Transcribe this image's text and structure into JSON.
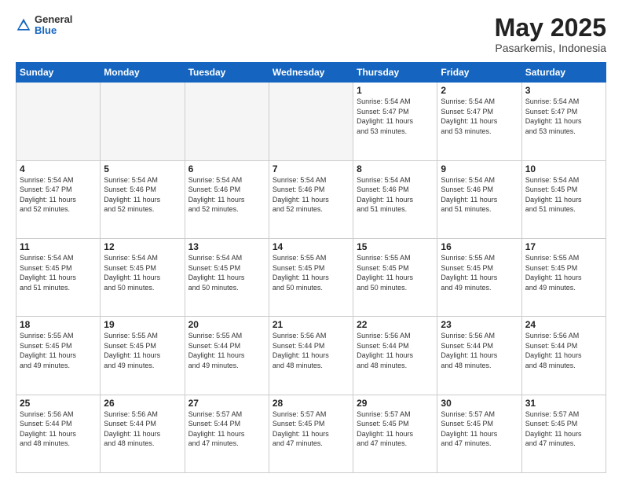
{
  "header": {
    "logo_general": "General",
    "logo_blue": "Blue",
    "month": "May 2025",
    "location": "Pasarkemis, Indonesia"
  },
  "days_of_week": [
    "Sunday",
    "Monday",
    "Tuesday",
    "Wednesday",
    "Thursday",
    "Friday",
    "Saturday"
  ],
  "weeks": [
    [
      {
        "day": "",
        "info": ""
      },
      {
        "day": "",
        "info": ""
      },
      {
        "day": "",
        "info": ""
      },
      {
        "day": "",
        "info": ""
      },
      {
        "day": "1",
        "info": "Sunrise: 5:54 AM\nSunset: 5:47 PM\nDaylight: 11 hours\nand 53 minutes."
      },
      {
        "day": "2",
        "info": "Sunrise: 5:54 AM\nSunset: 5:47 PM\nDaylight: 11 hours\nand 53 minutes."
      },
      {
        "day": "3",
        "info": "Sunrise: 5:54 AM\nSunset: 5:47 PM\nDaylight: 11 hours\nand 53 minutes."
      }
    ],
    [
      {
        "day": "4",
        "info": "Sunrise: 5:54 AM\nSunset: 5:47 PM\nDaylight: 11 hours\nand 52 minutes."
      },
      {
        "day": "5",
        "info": "Sunrise: 5:54 AM\nSunset: 5:46 PM\nDaylight: 11 hours\nand 52 minutes."
      },
      {
        "day": "6",
        "info": "Sunrise: 5:54 AM\nSunset: 5:46 PM\nDaylight: 11 hours\nand 52 minutes."
      },
      {
        "day": "7",
        "info": "Sunrise: 5:54 AM\nSunset: 5:46 PM\nDaylight: 11 hours\nand 52 minutes."
      },
      {
        "day": "8",
        "info": "Sunrise: 5:54 AM\nSunset: 5:46 PM\nDaylight: 11 hours\nand 51 minutes."
      },
      {
        "day": "9",
        "info": "Sunrise: 5:54 AM\nSunset: 5:46 PM\nDaylight: 11 hours\nand 51 minutes."
      },
      {
        "day": "10",
        "info": "Sunrise: 5:54 AM\nSunset: 5:45 PM\nDaylight: 11 hours\nand 51 minutes."
      }
    ],
    [
      {
        "day": "11",
        "info": "Sunrise: 5:54 AM\nSunset: 5:45 PM\nDaylight: 11 hours\nand 51 minutes."
      },
      {
        "day": "12",
        "info": "Sunrise: 5:54 AM\nSunset: 5:45 PM\nDaylight: 11 hours\nand 50 minutes."
      },
      {
        "day": "13",
        "info": "Sunrise: 5:54 AM\nSunset: 5:45 PM\nDaylight: 11 hours\nand 50 minutes."
      },
      {
        "day": "14",
        "info": "Sunrise: 5:55 AM\nSunset: 5:45 PM\nDaylight: 11 hours\nand 50 minutes."
      },
      {
        "day": "15",
        "info": "Sunrise: 5:55 AM\nSunset: 5:45 PM\nDaylight: 11 hours\nand 50 minutes."
      },
      {
        "day": "16",
        "info": "Sunrise: 5:55 AM\nSunset: 5:45 PM\nDaylight: 11 hours\nand 49 minutes."
      },
      {
        "day": "17",
        "info": "Sunrise: 5:55 AM\nSunset: 5:45 PM\nDaylight: 11 hours\nand 49 minutes."
      }
    ],
    [
      {
        "day": "18",
        "info": "Sunrise: 5:55 AM\nSunset: 5:45 PM\nDaylight: 11 hours\nand 49 minutes."
      },
      {
        "day": "19",
        "info": "Sunrise: 5:55 AM\nSunset: 5:45 PM\nDaylight: 11 hours\nand 49 minutes."
      },
      {
        "day": "20",
        "info": "Sunrise: 5:55 AM\nSunset: 5:44 PM\nDaylight: 11 hours\nand 49 minutes."
      },
      {
        "day": "21",
        "info": "Sunrise: 5:56 AM\nSunset: 5:44 PM\nDaylight: 11 hours\nand 48 minutes."
      },
      {
        "day": "22",
        "info": "Sunrise: 5:56 AM\nSunset: 5:44 PM\nDaylight: 11 hours\nand 48 minutes."
      },
      {
        "day": "23",
        "info": "Sunrise: 5:56 AM\nSunset: 5:44 PM\nDaylight: 11 hours\nand 48 minutes."
      },
      {
        "day": "24",
        "info": "Sunrise: 5:56 AM\nSunset: 5:44 PM\nDaylight: 11 hours\nand 48 minutes."
      }
    ],
    [
      {
        "day": "25",
        "info": "Sunrise: 5:56 AM\nSunset: 5:44 PM\nDaylight: 11 hours\nand 48 minutes."
      },
      {
        "day": "26",
        "info": "Sunrise: 5:56 AM\nSunset: 5:44 PM\nDaylight: 11 hours\nand 48 minutes."
      },
      {
        "day": "27",
        "info": "Sunrise: 5:57 AM\nSunset: 5:44 PM\nDaylight: 11 hours\nand 47 minutes."
      },
      {
        "day": "28",
        "info": "Sunrise: 5:57 AM\nSunset: 5:45 PM\nDaylight: 11 hours\nand 47 minutes."
      },
      {
        "day": "29",
        "info": "Sunrise: 5:57 AM\nSunset: 5:45 PM\nDaylight: 11 hours\nand 47 minutes."
      },
      {
        "day": "30",
        "info": "Sunrise: 5:57 AM\nSunset: 5:45 PM\nDaylight: 11 hours\nand 47 minutes."
      },
      {
        "day": "31",
        "info": "Sunrise: 5:57 AM\nSunset: 5:45 PM\nDaylight: 11 hours\nand 47 minutes."
      }
    ]
  ]
}
